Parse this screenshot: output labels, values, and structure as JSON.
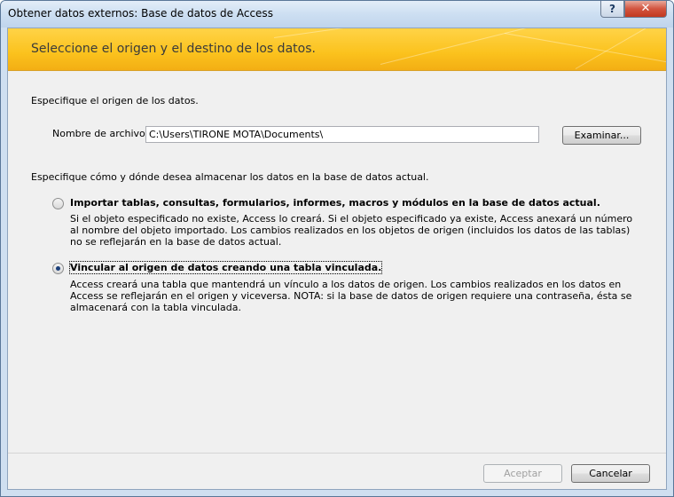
{
  "window": {
    "title": "Obtener datos externos: Base de datos de Access",
    "help_label": "?",
    "close_label": "✕"
  },
  "banner": {
    "title": "Seleccione el origen y el destino de los datos."
  },
  "source": {
    "heading": "Especifique el origen de los datos.",
    "file_label": "Nombre de archivo:",
    "file_value": "C:\\Users\\TIRONE MOTA\\Documents\\",
    "browse_label": "Examinar..."
  },
  "storage": {
    "heading": "Especifique cómo y dónde desea almacenar los datos en la base de datos actual.",
    "options": [
      {
        "label": "Importar tablas, consultas, formularios, informes, macros y módulos en la base de datos actual.",
        "description": "Si el objeto especificado no existe, Access lo creará. Si el objeto especificado ya existe, Access anexará un número al nombre del objeto importado. Los cambios realizados en los objetos de origen (incluidos los datos de las tablas) no se reflejarán en la base de datos actual.",
        "selected": false
      },
      {
        "label": "Vincular al origen de datos creando una tabla vinculada.",
        "description": "Access creará una tabla que mantendrá un vínculo a los datos de origen. Los cambios realizados en los datos en Access se reflejarán en el origen y viceversa. NOTA: si la base de datos de origen requiere una contraseña, ésta se almacenará con la tabla vinculada.",
        "selected": true
      }
    ]
  },
  "footer": {
    "ok_label": "Aceptar",
    "ok_enabled": false,
    "cancel_label": "Cancelar"
  },
  "colors": {
    "banner": "#fbc21d",
    "titlebar": "#cddff2",
    "close_button": "#c23920"
  }
}
